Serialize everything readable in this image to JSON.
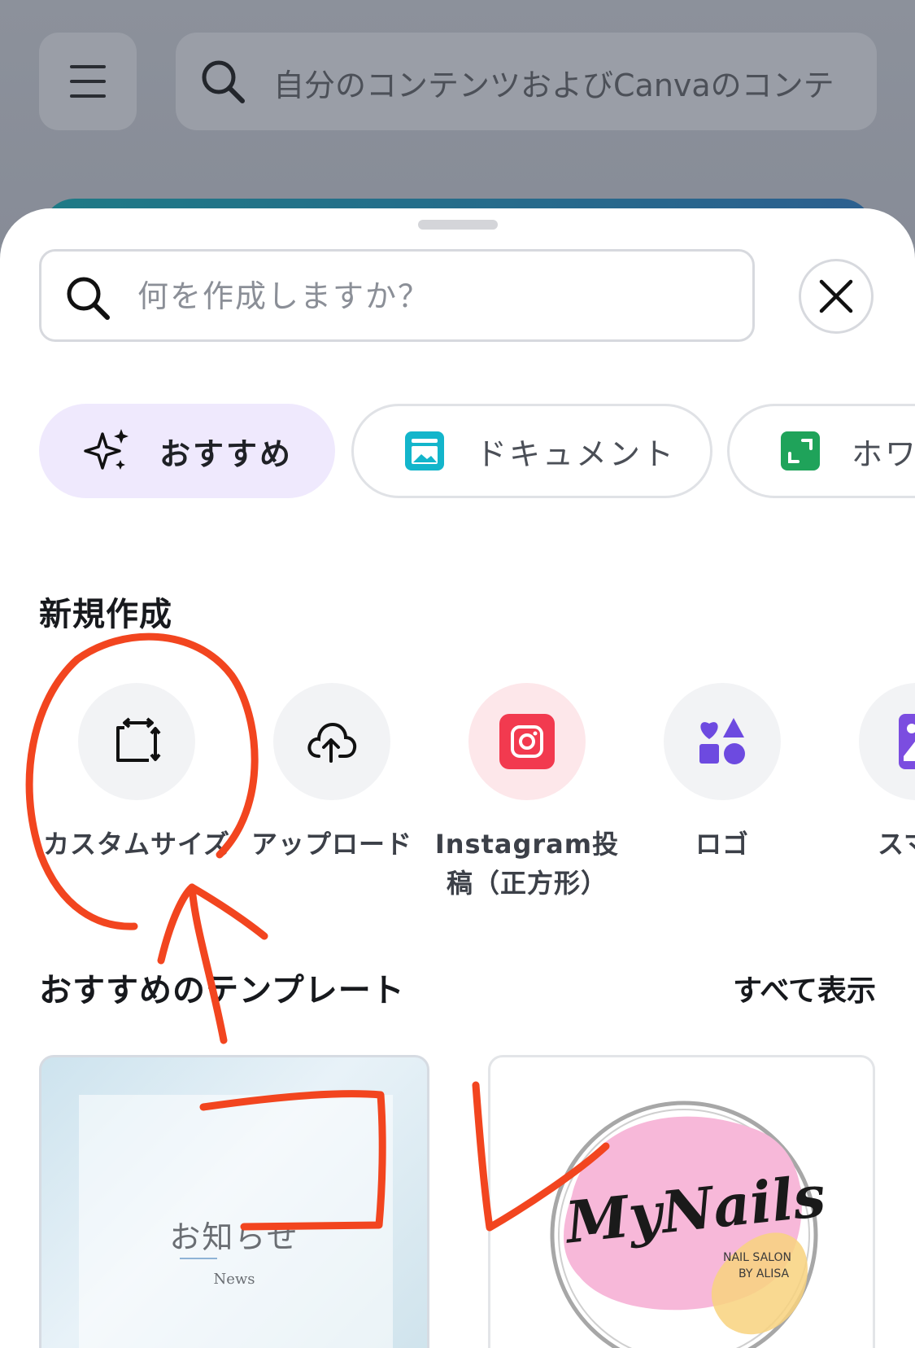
{
  "background": {
    "menu_icon": "hamburger-icon",
    "search_placeholder": "自分のコンテンツおよびCanvaのコンテ"
  },
  "sheet": {
    "search": {
      "placeholder": "何を作成しますか？",
      "icon": "search-icon"
    },
    "close_icon": "close-icon",
    "chips": [
      {
        "label": "おすすめ",
        "icon": "sparkle-icon",
        "active": true
      },
      {
        "label": "ドキュメント",
        "icon": "document-icon",
        "active": false,
        "color": "#13b5cb"
      },
      {
        "label": "ホワ",
        "icon": "whiteboard-icon",
        "active": false,
        "color": "#1fa35a"
      }
    ],
    "create_title": "新規作成",
    "create_items": [
      {
        "label": "カスタムサイズ",
        "icon": "resize-icon"
      },
      {
        "label": "アップロード",
        "icon": "cloud-upload-icon"
      },
      {
        "label": "Instagram投稿（正方形）",
        "icon": "instagram-icon",
        "color": "#f23a4f"
      },
      {
        "label": "ロゴ",
        "icon": "shapes-icon",
        "color": "#6d4ae0"
      },
      {
        "label": "スマホ",
        "icon": "phone-wallpaper-icon",
        "color": "#7b4de0"
      }
    ],
    "templates_title": "おすすめのテンプレート",
    "see_all": "すべて表示",
    "templates": [
      {
        "title": "お知らせ",
        "subtitle": "News"
      },
      {
        "title": "MyNails",
        "line1": "NAIL SALON",
        "line2": "BY ALISA"
      }
    ]
  },
  "annotation_color": "#f2451f"
}
